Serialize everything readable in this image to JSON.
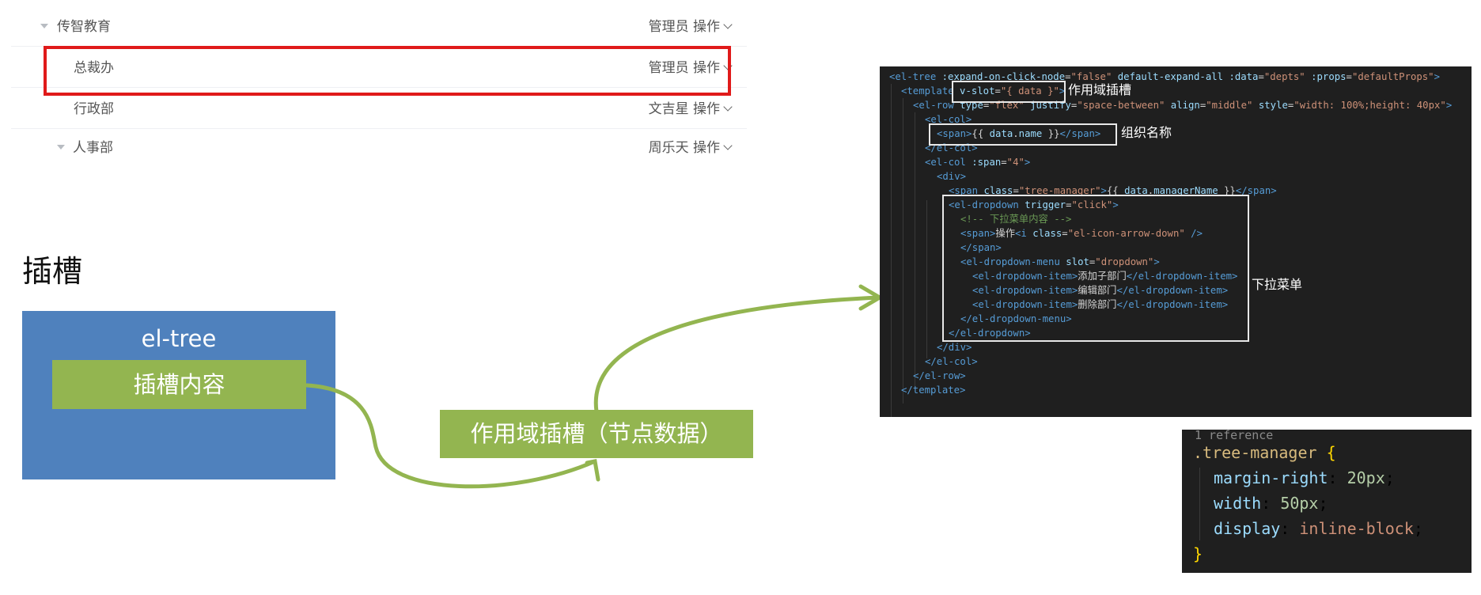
{
  "tree": {
    "rows": [
      {
        "name": "传智教育",
        "manager": "管理员",
        "action": "操作"
      },
      {
        "name": "总裁办",
        "manager": "管理员",
        "action": "操作"
      },
      {
        "name": "行政部",
        "manager": "文吉星",
        "action": "操作"
      },
      {
        "name": "人事部",
        "manager": "周乐天",
        "action": "操作"
      }
    ]
  },
  "diagram": {
    "title": "插槽",
    "component_label": "el-tree",
    "slot_label": "插槽内容",
    "scoped_slot_label": "作用域插槽（节点数据）"
  },
  "code": {
    "notes": {
      "scoped_slot": "作用域插槽",
      "org_name": "组织名称",
      "dropdown": "下拉菜单"
    }
  },
  "css": {
    "reference": "1 reference",
    "selector": ".tree-manager",
    "open_brace": "{",
    "close_brace": "}",
    "declarations": [
      {
        "prop": "margin-right",
        "value": "20px",
        "kind": "num"
      },
      {
        "prop": "width",
        "value": "50px",
        "kind": "num"
      },
      {
        "prop": "display",
        "value": "inline-block",
        "kind": "val"
      }
    ]
  },
  "colors": {
    "highlight": "#e01a1a",
    "blue_box": "#4f81bd",
    "green": "#93b550",
    "code_bg": "#1f1f1f"
  }
}
